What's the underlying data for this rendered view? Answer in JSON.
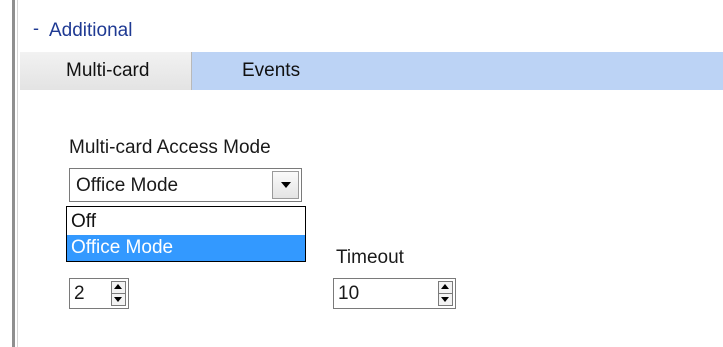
{
  "section": {
    "collapse_icon": "collapse-icon",
    "collapse_glyph": "-",
    "title": "Additional"
  },
  "tabs": [
    {
      "label": "Multi-card",
      "active": true
    },
    {
      "label": "Events",
      "active": false
    }
  ],
  "multicard": {
    "access_mode": {
      "label": "Multi-card Access Mode",
      "selected": "Office Mode",
      "options": [
        "Off",
        "Office Mode"
      ],
      "highlighted": "Office Mode"
    },
    "size": {
      "value": "2"
    },
    "timeout": {
      "label": "Timeout",
      "value": "10"
    }
  },
  "colors": {
    "header_text": "#1f3a93",
    "tabbar_bg": "#bcd3f5",
    "selection_bg": "#3399ff"
  }
}
